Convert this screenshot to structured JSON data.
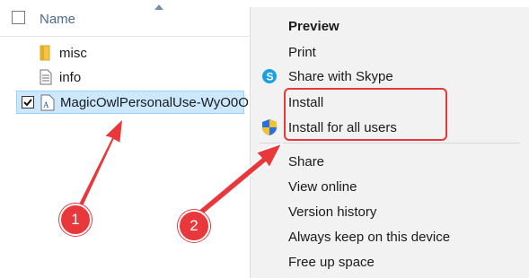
{
  "explorer": {
    "column_header": "Name",
    "files": [
      {
        "name": "misc",
        "icon": "folder-icon"
      },
      {
        "name": "info",
        "icon": "text-file-icon"
      },
      {
        "name": "MagicOwlPersonalUse-WyO0O",
        "icon": "font-file-icon",
        "selected": true,
        "checked": true
      }
    ]
  },
  "context_menu": {
    "items": [
      {
        "label": "Preview",
        "bold": true
      },
      {
        "label": "Print"
      },
      {
        "label": "Share with Skype",
        "icon": "skype-icon"
      },
      {
        "label": "Install"
      },
      {
        "label": "Install for all users",
        "icon": "uac-shield-icon"
      },
      {
        "label": "Share",
        "icon": "share-icon"
      },
      {
        "label": "View online"
      },
      {
        "label": "Version history"
      },
      {
        "label": "Always keep on this device"
      },
      {
        "label": "Free up space"
      }
    ]
  },
  "annotations": {
    "badge_1": "1",
    "badge_2": "2",
    "accent_color": "#e8383b"
  }
}
